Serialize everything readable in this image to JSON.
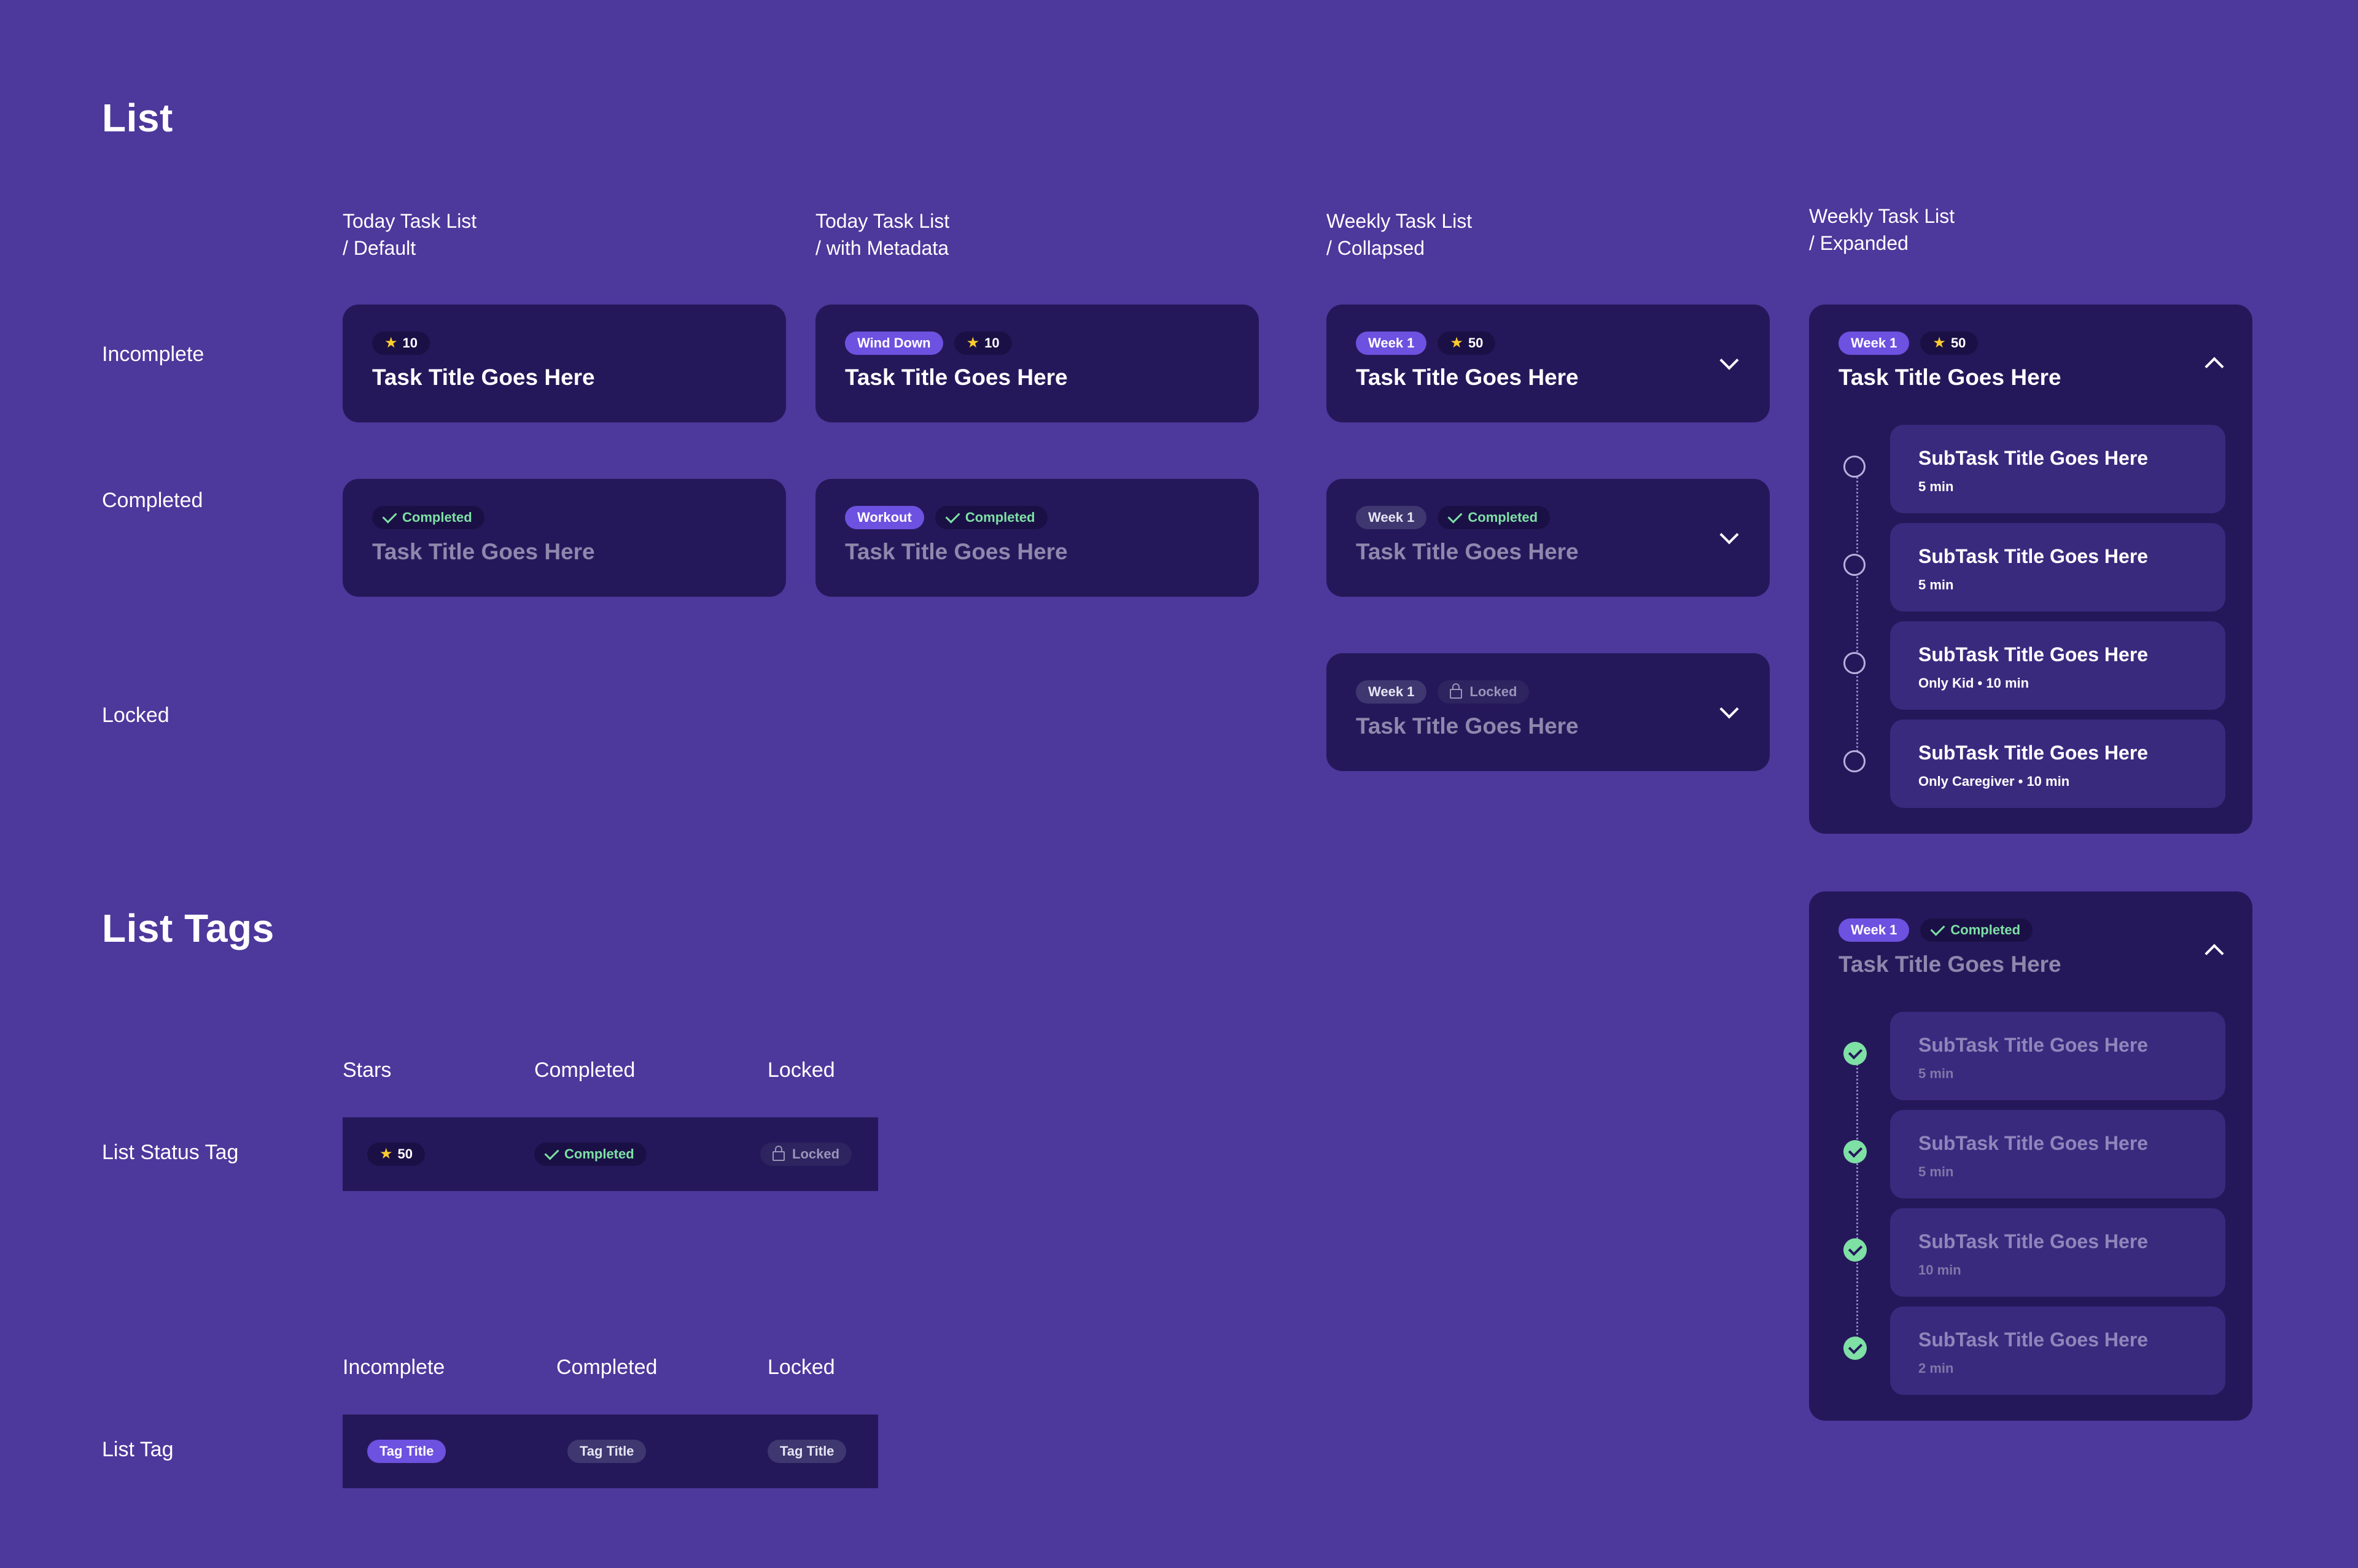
{
  "sections": {
    "list": "List",
    "list_tags": "List Tags"
  },
  "columns": [
    {
      "line1": "Today Task List",
      "line2": "/ Default"
    },
    {
      "line1": "Today Task List",
      "line2": "/ with Metadata"
    },
    {
      "line1": "Weekly Task List",
      "line2": "/ Collapsed"
    },
    {
      "line1": "Weekly Task List",
      "line2": "/ Expanded"
    }
  ],
  "rows": {
    "incomplete": "Incomplete",
    "completed": "Completed",
    "locked": "Locked"
  },
  "task_title": "Task Title Goes Here",
  "tags": {
    "stars10": "10",
    "stars50": "50",
    "wind_down": "Wind Down",
    "workout": "Workout",
    "week1": "Week 1",
    "completed": "Completed",
    "locked": "Locked"
  },
  "subtasks_incomplete": [
    {
      "title": "SubTask Title Goes Here",
      "meta": "5 min"
    },
    {
      "title": "SubTask Title Goes Here",
      "meta": "5 min"
    },
    {
      "title": "SubTask Title Goes Here",
      "meta": "Only Kid • 10 min"
    },
    {
      "title": "SubTask Title Goes Here",
      "meta": "Only Caregiver • 10 min"
    }
  ],
  "subtasks_completed": [
    {
      "title": "SubTask Title Goes Here",
      "meta": "5 min"
    },
    {
      "title": "SubTask Title Goes Here",
      "meta": "5 min"
    },
    {
      "title": "SubTask Title Goes Here",
      "meta": "10 min"
    },
    {
      "title": "SubTask Title Goes Here",
      "meta": "2 min"
    }
  ],
  "status_tag": {
    "row_label": "List Status Tag",
    "h_stars": "Stars",
    "h_completed": "Completed",
    "h_locked": "Locked"
  },
  "list_tag": {
    "row_label": "List Tag",
    "h_incomplete": "Incomplete",
    "h_completed": "Completed",
    "h_locked": "Locked",
    "tag_title": "Tag Title"
  },
  "colors": {
    "background": "#4d389c",
    "card": "#25185a",
    "accent": "#6d51e0",
    "success": "#7ee0a5",
    "star": "#ffcc2e"
  }
}
